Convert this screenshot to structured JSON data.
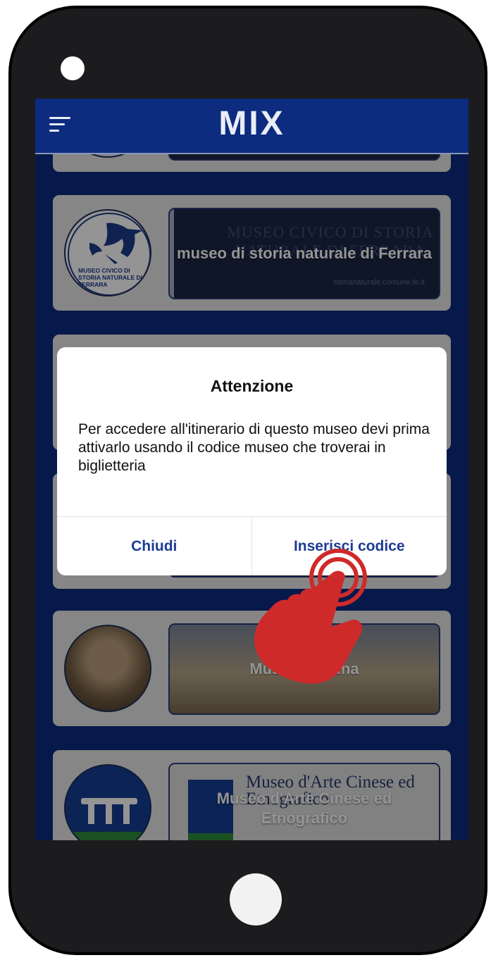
{
  "app": {
    "title": "MIX"
  },
  "museums": [
    {
      "name": "",
      "banner_text": ""
    },
    {
      "name": "museo di storia naturale di Ferrara",
      "logo_text": "MUSEO CIVICO DI STORIA NATURALE DI FERRARA",
      "banner_text": "MUSEO CIVICO DI STORIA NATURALE DI FERRARA",
      "banner_url": "storianaturale.comune.fe.it"
    },
    {
      "name": "",
      "banner_text": ""
    },
    {
      "name": "",
      "banner_text": ""
    },
    {
      "name": "Museo Ericena",
      "banner_text": ""
    },
    {
      "name": "Museo d'Arte Cinese ed Etnografico",
      "banner_text": "Museo d'Arte Cinese ed Etnografico"
    }
  ],
  "dialog": {
    "title": "Attenzione",
    "message": "Per accedere all'itinerario di questo museo devi prima attivarlo usando il codice museo che troverai in biglietteria",
    "cancel_label": "Chiudi",
    "confirm_label": "Inserisci codice"
  },
  "icons": {
    "menu": "hamburger-menu-icon",
    "hand": "tap-hand-icon"
  },
  "colors": {
    "primary": "#0d2c80",
    "card": "#e7e7e7",
    "dialog_button": "#1c3c94",
    "hand": "#cf2a2a"
  }
}
